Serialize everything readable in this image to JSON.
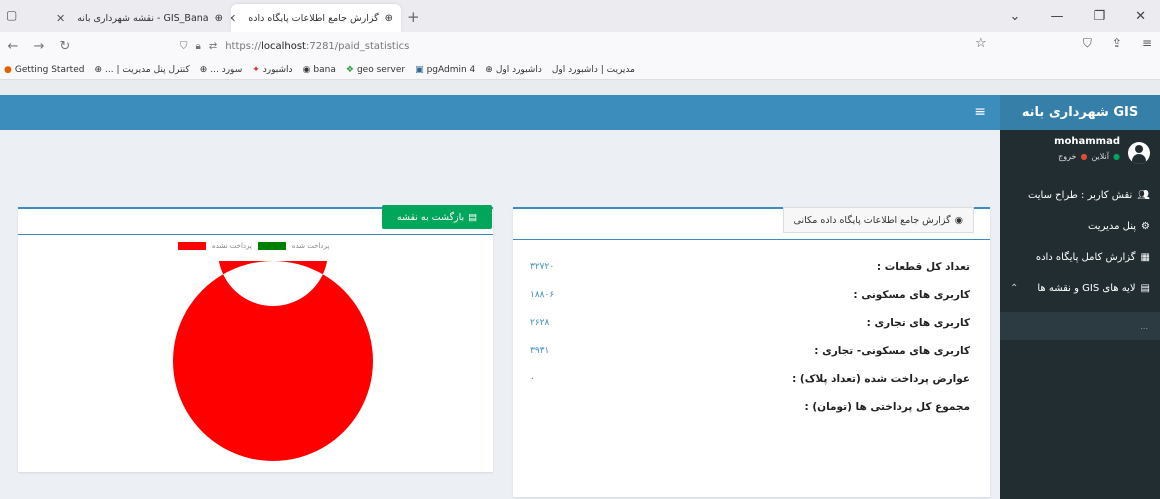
{
  "browser": {
    "tabs": [
      {
        "label": "GIS_Bana - نقشه شهرداری بانه",
        "active": false
      },
      {
        "label": "گزارش جامع اطلاعات پایگاه داده",
        "active": true
      }
    ],
    "url_prefix": "https://",
    "url_host": "localhost",
    "url_path": ":7281/paid_statistics",
    "bookmarks": [
      {
        "label": "Getting Started",
        "icon": "firefox-icon"
      },
      {
        "label": "... | کنترل پنل مدیریت",
        "icon": "globe-icon"
      },
      {
        "label": "... سورد",
        "icon": "globe-icon"
      },
      {
        "label": "داشبورد",
        "icon": "star-icon"
      },
      {
        "label": "bana",
        "icon": "globe-icon"
      },
      {
        "label": "geo server",
        "icon": "geoserver-icon"
      },
      {
        "label": "pgAdmin 4",
        "icon": "pgadmin-icon"
      },
      {
        "label": "داشبورد اول",
        "icon": "globe-icon"
      },
      {
        "label": "مدیریت | داشبورد اول",
        "icon": "none"
      }
    ]
  },
  "app": {
    "brand": "GIS شهرداری بانه",
    "user": {
      "name": "mohammad",
      "status_online": "آنلاین",
      "status_logout": "خروج"
    },
    "menu": [
      {
        "label": "نقش کاربر : طراح سایت",
        "icon": "user-role-icon"
      },
      {
        "label": "پنل مدیریت",
        "icon": "cogs-icon"
      },
      {
        "label": "گزارش کامل پایگاه داده",
        "icon": "database-icon"
      },
      {
        "label": "لایه های GIS و نقشه ها",
        "icon": "map-icon",
        "expandable": true
      }
    ],
    "submenu_label": "..."
  },
  "left_panel": {
    "back_button_label": "بازگشت به نقشه",
    "legend": [
      {
        "label": "پرداخت شده",
        "color": "#008000"
      },
      {
        "label": "پرداخت نشده",
        "color": "#ff0000"
      }
    ]
  },
  "chart_data": {
    "type": "pie",
    "categories": [
      "پرداخت شده",
      "پرداخت نشده"
    ],
    "values": [
      0,
      100
    ],
    "colors": [
      "#008000",
      "#ff0000"
    ],
    "donut": true,
    "legend_position": "top"
  },
  "right_panel": {
    "title": "گزارش جامع اطلاعات پایگاه داده مکانی",
    "stats": [
      {
        "label": "تعداد کل قطعات :",
        "value": "۳۲۷۲۰"
      },
      {
        "label": "کاربری های مسکونی :",
        "value": "۱۸۸۰۶"
      },
      {
        "label": "کاربری های تجاری :",
        "value": "۲۶۲۸"
      },
      {
        "label": "کاربری های مسکونی- تجاری :",
        "value": "۳۹۳۱"
      },
      {
        "label": "عوارض پرداخت شده (تعداد پلاک) :",
        "value": "۰"
      },
      {
        "label": "مجموع کل پرداختی ها (تومان) :",
        "value": ""
      }
    ]
  }
}
